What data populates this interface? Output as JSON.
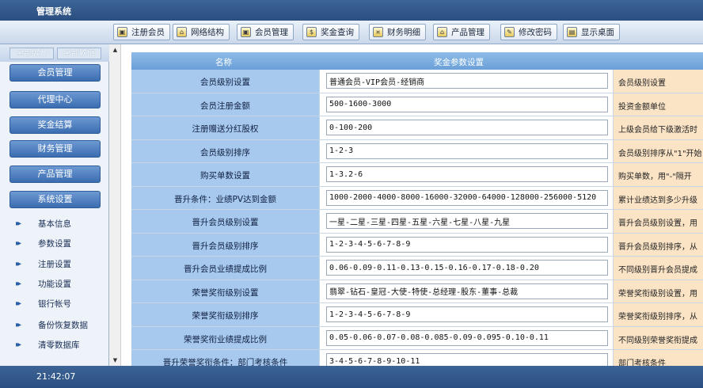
{
  "app": {
    "title": "管理系统"
  },
  "toolbar": [
    {
      "label": "注册会员",
      "icon": "user-add-icon"
    },
    {
      "label": "网络结构",
      "icon": "network-icon"
    },
    {
      "label": "会员管理",
      "icon": "members-icon"
    },
    {
      "label": "奖金查询",
      "icon": "bonus-search-icon"
    },
    {
      "label": "财务明细",
      "icon": "finance-icon"
    },
    {
      "label": "产品管理",
      "icon": "product-icon"
    },
    {
      "label": "修改密码",
      "icon": "password-icon"
    },
    {
      "label": "显示桌面",
      "icon": "desktop-icon"
    }
  ],
  "sidebar": {
    "expand_all": "全部展开",
    "collapse_all": "全部收缩",
    "menus": [
      "会员管理",
      "代理中心",
      "奖金结算",
      "财务管理",
      "产品管理",
      "系统设置"
    ],
    "sub_items": [
      "基本信息",
      "参数设置",
      "注册设置",
      "功能设置",
      "银行帐号",
      "备份恢复数据",
      "清零数据库"
    ]
  },
  "table": {
    "headers": [
      "名称",
      "奖金参数设置"
    ],
    "rows": [
      {
        "name": "会员级别设置",
        "value": "普通会员-VIP会员-经销商",
        "note": "会员级别设置"
      },
      {
        "name": "会员注册金额",
        "value": "500-1600-3000",
        "note": "投资金额单位"
      },
      {
        "name": "注册赠送分红股权",
        "value": "0-100-200",
        "note": "上级会员给下级激活时"
      },
      {
        "name": "会员级别排序",
        "value": "1-2-3",
        "note": "会员级别排序从\"1\"开始"
      },
      {
        "name": "购买单数设置",
        "value": "1-3.2-6",
        "note": "购买单数，用\"-\"隔开"
      },
      {
        "name": "晋升条件：业绩PV达到金额",
        "value": "1000-2000-4000-8000-16000-32000-64000-128000-256000-5120",
        "note": "累计业绩达到多少升级"
      },
      {
        "name": "晋升会员级别设置",
        "value": "一星-二星-三星-四星-五星-六星-七星-八星-九星",
        "note": "晋升会员级别设置，用"
      },
      {
        "name": "晋升会员级别排序",
        "value": "1-2-3-4-5-6-7-8-9",
        "note": "晋升会员级别排序，从"
      },
      {
        "name": "晋升会员业绩提成比例",
        "value": "0.06-0.09-0.11-0.13-0.15-0.16-0.17-0.18-0.20",
        "note": "不同级别晋升会员提成"
      },
      {
        "name": "荣誉奖衔级别设置",
        "value": "翡翠-钻石-皇冠-大使-特使-总经理-股东-董事-总裁",
        "note": "荣誉奖衔级别设置，用"
      },
      {
        "name": "荣誉奖衔级别排序",
        "value": "1-2-3-4-5-6-7-8-9",
        "note": "荣誉奖衔级别排序，从"
      },
      {
        "name": "荣誉奖衔业绩提成比例",
        "value": "0.05-0.06-0.07-0.08-0.085-0.09-0.095-0.10-0.11",
        "note": "不同级别荣誉奖衔提成"
      },
      {
        "name": "晋升荣誉奖衔条件：部门考核条件",
        "value": "3-4-5-6-7-8-9-10-11",
        "note": "部门考核条件"
      }
    ]
  },
  "status": {
    "time": "21:42:07"
  },
  "colors": {
    "titlebar": "#2f5486",
    "header": "#7aaee0",
    "name_cell": "#a7c9ee",
    "note_cell": "#fbe4c6"
  }
}
